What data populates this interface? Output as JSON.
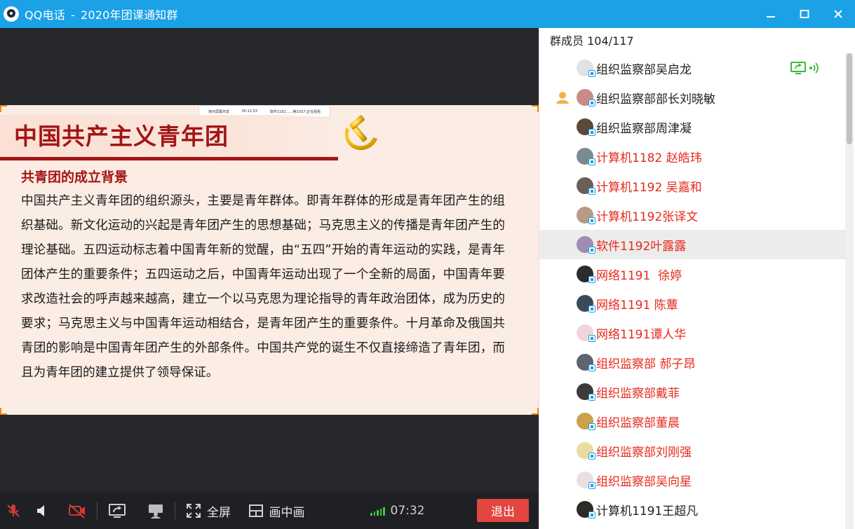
{
  "window": {
    "app_name": "QQ电话",
    "separator": "-",
    "group_name": "2020年团课通知群"
  },
  "slide": {
    "title": "中国共产主义青年团",
    "subtitle": "共青团的成立背景",
    "body": "中国共产主义青年团的组织源头，主要是青年群体。即青年群体的形成是青年团产生的组织基础。新文化运动的兴起是青年团产生的思想基础；马克思主义的传播是青年团产生的理论基础。五四运动标志着中国青年新的觉醒，由“五四”开始的青年运动的实践，是青年团体产生的重要条件；五四运动之后，中国青年运动出现了一个全新的局面，中国青年要求改造社会的呼声越来越高，建立一个以马克思为理论指导的青年政治团体，成为历史的要求；马克思主义与中国青年运动相结合，是青年团产生的重要条件。十月革命及俄国共青团的影响是中国青年团产生的外部条件。中国共产党的诞生不仅直接缔造了青年团，而且为青年团的建立提供了领导保证。",
    "share_bar_items": [
      "演示屏幕共享",
      "00:11:53",
      "软件1192……等103人正在观看"
    ]
  },
  "toolbar": {
    "fullscreen_label": "全屏",
    "pip_label": "画中画",
    "timer": "07:32",
    "exit_label": "退出",
    "signal_bars": 5
  },
  "members": {
    "header": "群成员 104/117",
    "list": [
      {
        "name": "组织监察部吴启龙",
        "color": "black",
        "host": false,
        "sharing": true,
        "avatar": "#dfe3e8"
      },
      {
        "name": "组织监察部部长刘晓敏",
        "color": "black",
        "host": true,
        "sharing": false,
        "avatar": "#c98a8a"
      },
      {
        "name": "组织监察部周津凝",
        "color": "black",
        "host": false,
        "sharing": false,
        "avatar": "#5a4a3a"
      },
      {
        "name": "计算机1182 赵皓玮",
        "color": "red",
        "host": false,
        "sharing": false,
        "avatar": "#7a8a90"
      },
      {
        "name": "计算机1192 吴嘉和",
        "color": "red",
        "host": false,
        "sharing": false,
        "avatar": "#6a6058"
      },
      {
        "name": "计算机1192张译文",
        "color": "red",
        "host": false,
        "sharing": false,
        "avatar": "#b89a86"
      },
      {
        "name": "软件1192叶露露",
        "color": "red",
        "host": false,
        "sharing": false,
        "avatar": "#a08cb0",
        "selected": true
      },
      {
        "name": "网络1191  徐婷",
        "color": "red",
        "host": false,
        "sharing": false,
        "avatar": "#2b2b30"
      },
      {
        "name": "网络1191 陈蕈",
        "color": "red",
        "host": false,
        "sharing": false,
        "avatar": "#3a4a5a"
      },
      {
        "name": "网络1191谭人华",
        "color": "red",
        "host": false,
        "sharing": false,
        "avatar": "#f0d6dc"
      },
      {
        "name": "组织监察部 郝子昂",
        "color": "red",
        "host": false,
        "sharing": false,
        "avatar": "#5e6470"
      },
      {
        "name": "组织监察部戴菲",
        "color": "red",
        "host": false,
        "sharing": false,
        "avatar": "#3d3a3a"
      },
      {
        "name": "组织监察部董晨",
        "color": "red",
        "host": false,
        "sharing": false,
        "avatar": "#c9a24a"
      },
      {
        "name": "组织监察部刘刚强",
        "color": "red",
        "host": false,
        "sharing": false,
        "avatar": "#e8dca0"
      },
      {
        "name": "组织监察部吴向星",
        "color": "red",
        "host": false,
        "sharing": false,
        "avatar": "#e6e0e0"
      },
      {
        "name": "计算机1191王超凡",
        "color": "black",
        "host": false,
        "sharing": false,
        "avatar": "#2e2a26"
      }
    ]
  },
  "colors": {
    "titlebar": "#1aa1e6",
    "slide_red": "#a31515",
    "member_red": "#e6291b",
    "exit_button": "#e2463f",
    "signal_green": "#3cc63c"
  },
  "icons": {
    "mic": "mic-muted-icon",
    "speaker": "speaker-icon",
    "camera": "camera-off-icon",
    "share": "screen-share-icon",
    "presenter": "presenter-icon",
    "fullscreen": "fullscreen-icon",
    "pip": "picture-in-picture-icon",
    "host": "host-icon",
    "sharing": "sharing-screen-icon",
    "speaking": "speaking-icon"
  }
}
